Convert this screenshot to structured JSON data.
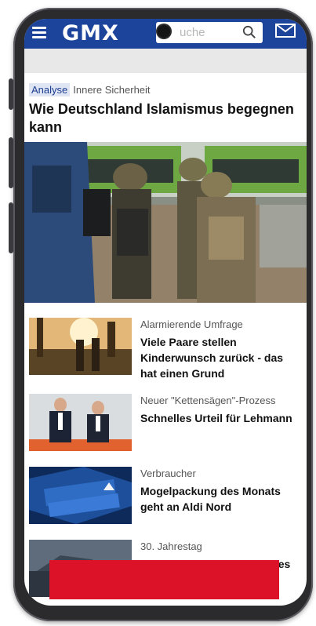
{
  "header": {
    "logo": "GMX",
    "search_placeholder": "Suche",
    "search_visible_text": "uche",
    "icons": [
      "menu-icon",
      "search-icon",
      "mail-icon"
    ],
    "brand_color": "#1c449b"
  },
  "lead": {
    "tag": "Analyse",
    "category": "Innere Sicherheit",
    "headline": "Wie Deutschland Islamismus begegnen kann"
  },
  "articles": [
    {
      "kicker": "Alarmierende Umfrage",
      "title": "Viele Paare stellen Kinderwunsch zurück - das hat einen Grund"
    },
    {
      "kicker": "Neuer \"Kettensägen\"-Prozess",
      "title": "Schnelles Urteil für Lehmann"
    },
    {
      "kicker": "Verbraucher",
      "title": "Mogelpackung des Monats geht an Aldi Nord"
    },
    {
      "kicker": "30. Jahrestag",
      "title": "\"Estonia\"-Untergang: Wie es"
    }
  ],
  "accent_red": "#dc1328"
}
